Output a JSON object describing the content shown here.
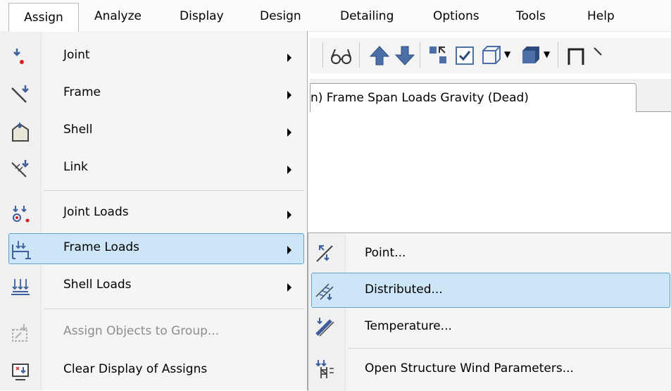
{
  "menubar": {
    "items": [
      "Assign",
      "Analyze",
      "Display",
      "Design",
      "Detailing",
      "Options",
      "Tools",
      "Help"
    ],
    "active": "Assign"
  },
  "document_tab": {
    "title": "n)  Frame Span Loads Gravity (Dead)"
  },
  "assign_menu": {
    "items": [
      {
        "label": "Joint",
        "icon": "joint-icon",
        "submenu": true
      },
      {
        "label": "Frame",
        "icon": "frame-icon",
        "submenu": true
      },
      {
        "label": "Shell",
        "icon": "shell-icon",
        "submenu": true
      },
      {
        "label": "Link",
        "icon": "link-icon",
        "submenu": true
      },
      {
        "label": "Joint Loads",
        "icon": "joint-loads-icon",
        "submenu": true
      },
      {
        "label": "Frame Loads",
        "icon": "frame-loads-icon",
        "submenu": true,
        "highlighted": true
      },
      {
        "label": "Shell Loads",
        "icon": "shell-loads-icon",
        "submenu": true
      },
      {
        "label": "Assign Objects to Group...",
        "icon": "group-icon",
        "disabled": true
      },
      {
        "label": "Clear Display of Assigns",
        "icon": "clear-display-icon"
      }
    ]
  },
  "frame_loads_submenu": {
    "items": [
      {
        "label": "Point...",
        "icon": "point-load-icon"
      },
      {
        "label": "Distributed...",
        "icon": "distributed-load-icon",
        "highlighted": true
      },
      {
        "label": "Temperature...",
        "icon": "temperature-load-icon"
      },
      {
        "label": "Open Structure Wind Parameters...",
        "icon": "wind-parameters-icon"
      }
    ]
  },
  "toolbar": {
    "icons": [
      "glasses-icon",
      "arrow-up-icon",
      "arrow-down-icon",
      "select-icon",
      "checkbox-icon",
      "box-view-icon",
      "solid-view-icon",
      "frame-icon"
    ]
  },
  "colors": {
    "highlight_fill": "#cde6f7",
    "highlight_border": "#5aa4dd",
    "accent_red": "#d81e1e",
    "icon_blue": "#3f5f9c"
  }
}
